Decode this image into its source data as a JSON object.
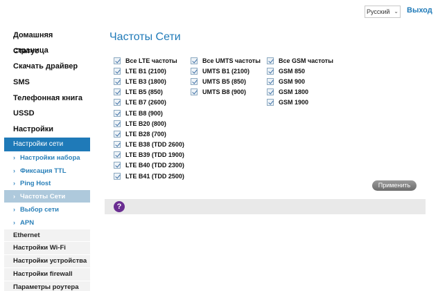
{
  "header": {
    "language": "Русский",
    "logout": "Выход"
  },
  "sidebar": {
    "main_items": [
      "Домашняя страница",
      "Статус",
      "Скачать драйвер",
      "SMS",
      "Телефонная книга",
      "USSD",
      "Настройки"
    ],
    "active_group": "Настройки сети",
    "sub_items": [
      "Настройки набора",
      "Фиксация TTL",
      "Ping Host",
      "Частоты Сети",
      "Выбор сети",
      "APN"
    ],
    "active_sub": "Частоты Сети",
    "other_items": [
      "Ethernet",
      "Настройки Wi-Fi",
      "Настройки устройства",
      "Настройки firewall",
      "Параметры роутера"
    ]
  },
  "main": {
    "title": "Частоты Сети",
    "lte": [
      "Все LTE частоты",
      "LTE B1 (2100)",
      "LTE B3 (1800)",
      "LTE B5 (850)",
      "LTE B7 (2600)",
      "LTE B8 (900)",
      "LTE B20 (800)",
      "LTE B28 (700)",
      "LTE B38 (TDD 2600)",
      "LTE B39 (TDD 1900)",
      "LTE B40 (TDD 2300)",
      "LTE B41 (TDD 2500)"
    ],
    "umts": [
      "Все UMTS частоты",
      "UMTS B1 (2100)",
      "UMTS B5 (850)",
      "UMTS B8 (900)"
    ],
    "gsm": [
      "Все GSM частоты",
      "GSM 850",
      "GSM 900",
      "GSM 1800",
      "GSM 1900"
    ],
    "apply_label": "Применить",
    "help_symbol": "?"
  }
}
